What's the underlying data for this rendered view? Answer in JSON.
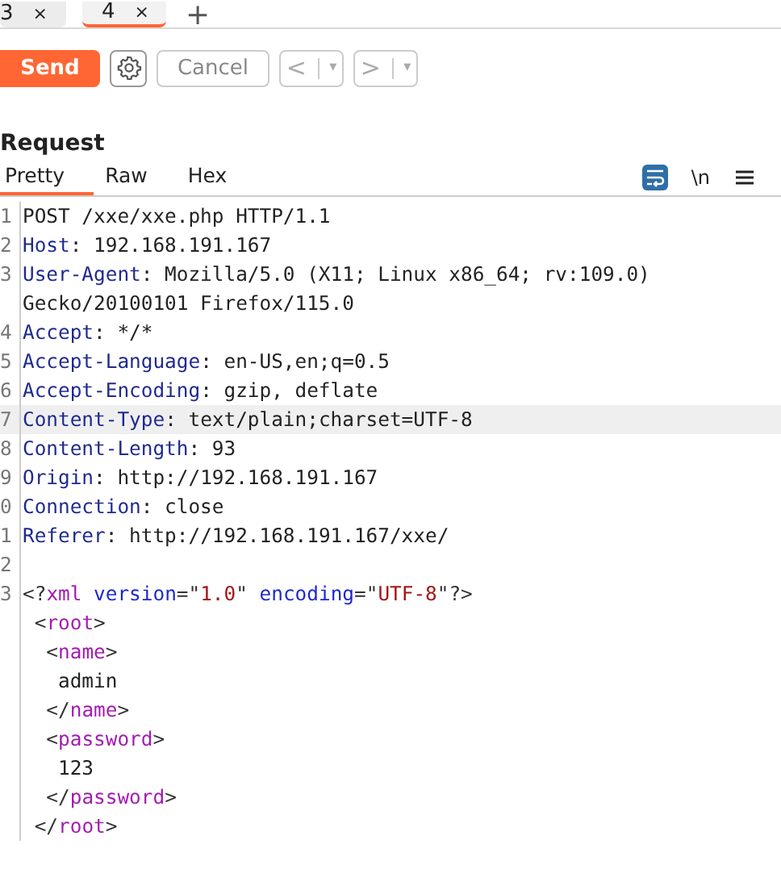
{
  "tabs": [
    {
      "label": "3",
      "close": "×",
      "selected": false
    },
    {
      "label": "4",
      "close": "×",
      "selected": true
    }
  ],
  "new_tab": "+",
  "toolbar": {
    "send": "Send",
    "cancel": {
      "label": "Cancel",
      "disabled": true
    },
    "nav": [
      {
        "label": "<",
        "caret": "▾",
        "disabled": true
      },
      {
        "label": ">",
        "caret": "▾",
        "disabled": true
      }
    ]
  },
  "request": {
    "title": "Request",
    "view_tabs": [
      {
        "label": "Pretty",
        "selected": true
      },
      {
        "label": "Raw",
        "selected": false
      },
      {
        "label": "Hex",
        "selected": false
      }
    ],
    "wrap_selected": true,
    "newline_label": "\\n",
    "lines": [
      {
        "number": "1",
        "highlighted": false,
        "segments": [
          {
            "kind": "plain",
            "text": "POST /xxe/xxe.php HTTP/1.1"
          }
        ]
      },
      {
        "number": "2",
        "highlighted": false,
        "segments": [
          {
            "kind": "header",
            "text": "Host"
          },
          {
            "kind": "plain",
            "text": ": 192.168.191.167"
          }
        ]
      },
      {
        "number": "3",
        "highlighted": false,
        "segments": [
          {
            "kind": "header",
            "text": "User-Agent"
          },
          {
            "kind": "plain",
            "text": ": Mozilla/5.0 (X11; Linux x86_64; rv:109.0)"
          }
        ]
      },
      {
        "highlighted": false,
        "segments": [
          {
            "kind": "plain",
            "text": "Gecko/20100101 Firefox/115.0"
          }
        ]
      },
      {
        "number": "4",
        "highlighted": false,
        "segments": [
          {
            "kind": "header",
            "text": "Accept"
          },
          {
            "kind": "plain",
            "text": ": */*"
          }
        ]
      },
      {
        "number": "5",
        "highlighted": false,
        "segments": [
          {
            "kind": "header",
            "text": "Accept-Language"
          },
          {
            "kind": "plain",
            "text": ": en-US,en;q=0.5"
          }
        ]
      },
      {
        "number": "6",
        "highlighted": false,
        "segments": [
          {
            "kind": "header",
            "text": "Accept-Encoding"
          },
          {
            "kind": "plain",
            "text": ": gzip, deflate"
          }
        ]
      },
      {
        "number": "7",
        "highlighted": true,
        "segments": [
          {
            "kind": "header",
            "text": "Content-Type"
          },
          {
            "kind": "plain",
            "text": ": text/plain;charset=UTF-8"
          }
        ]
      },
      {
        "number": "8",
        "highlighted": false,
        "segments": [
          {
            "kind": "header",
            "text": "Content-Length"
          },
          {
            "kind": "plain",
            "text": ": 93"
          }
        ]
      },
      {
        "number": "9",
        "highlighted": false,
        "segments": [
          {
            "kind": "header",
            "text": "Origin"
          },
          {
            "kind": "plain",
            "text": ": http://192.168.191.167"
          }
        ]
      },
      {
        "number": "0",
        "highlighted": false,
        "segments": [
          {
            "kind": "header",
            "text": "Connection"
          },
          {
            "kind": "plain",
            "text": ": close"
          }
        ]
      },
      {
        "number": "1",
        "highlighted": false,
        "segments": [
          {
            "kind": "header",
            "text": "Referer"
          },
          {
            "kind": "plain",
            "text": ": http://192.168.191.167/xxe/"
          }
        ]
      },
      {
        "number": "2",
        "highlighted": false
      },
      {
        "number": "3",
        "highlighted": false,
        "segments": [
          {
            "kind": "punct",
            "text": "<?"
          },
          {
            "kind": "tag",
            "text": "xml"
          },
          {
            "kind": "attr",
            "text": " version"
          },
          {
            "kind": "punct",
            "text": "=\""
          },
          {
            "kind": "value",
            "text": "1.0"
          },
          {
            "kind": "punct",
            "text": "\""
          },
          {
            "kind": "attr",
            "text": " encoding"
          },
          {
            "kind": "punct",
            "text": "=\""
          },
          {
            "kind": "value",
            "text": "UTF-8"
          },
          {
            "kind": "punct",
            "text": "\"?>"
          }
        ]
      },
      {
        "highlighted": false,
        "segments": [
          {
            "kind": "punct",
            "text": " <"
          },
          {
            "kind": "tag",
            "text": "root"
          },
          {
            "kind": "punct",
            "text": ">"
          }
        ]
      },
      {
        "highlighted": false,
        "segments": [
          {
            "kind": "punct",
            "text": "  <"
          },
          {
            "kind": "tag",
            "text": "name"
          },
          {
            "kind": "punct",
            "text": ">"
          }
        ]
      },
      {
        "highlighted": false,
        "segments": [
          {
            "kind": "plain",
            "text": "   admin"
          }
        ]
      },
      {
        "highlighted": false,
        "segments": [
          {
            "kind": "punct",
            "text": "  </"
          },
          {
            "kind": "tag",
            "text": "name"
          },
          {
            "kind": "punct",
            "text": ">"
          }
        ]
      },
      {
        "highlighted": false,
        "segments": [
          {
            "kind": "punct",
            "text": "  <"
          },
          {
            "kind": "tag",
            "text": "password"
          },
          {
            "kind": "punct",
            "text": ">"
          }
        ]
      },
      {
        "highlighted": false,
        "segments": [
          {
            "kind": "plain",
            "text": "   123"
          }
        ]
      },
      {
        "highlighted": false,
        "segments": [
          {
            "kind": "punct",
            "text": "  </"
          },
          {
            "kind": "tag",
            "text": "password"
          },
          {
            "kind": "punct",
            "text": ">"
          }
        ]
      },
      {
        "highlighted": false,
        "segments": [
          {
            "kind": "punct",
            "text": " </"
          },
          {
            "kind": "tag",
            "text": "root"
          },
          {
            "kind": "punct",
            "text": ">"
          }
        ]
      }
    ]
  }
}
